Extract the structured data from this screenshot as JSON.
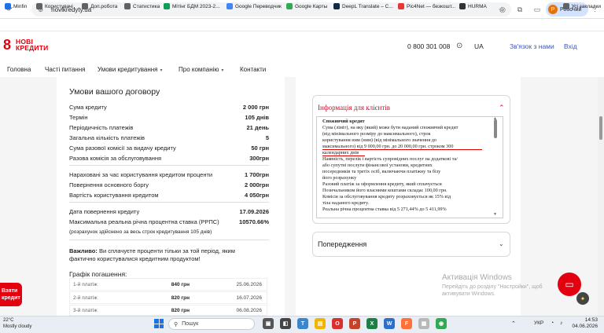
{
  "browser": {
    "url": "novikredyty.ua",
    "profile_initial": "Р",
    "profile_name": "Робочий",
    "bookmarks": [
      {
        "label": "Minfin",
        "color": "#1a73e8"
      },
      {
        "label": "Користувачі",
        "color": "#5f6368"
      },
      {
        "label": "Доп.робота",
        "color": "#5f6368"
      },
      {
        "label": "Статистика",
        "color": "#5f6368"
      },
      {
        "label": "Мітінг БДМ 2023-2...",
        "color": "#0f9d58"
      },
      {
        "label": "Google Переводчик",
        "color": "#4285f4"
      },
      {
        "label": "Google Карты",
        "color": "#34a853"
      },
      {
        "label": "DeepL Translate – С...",
        "color": "#0f2b46"
      },
      {
        "label": "Pic4Net — безкошт...",
        "color": "#e53935"
      },
      {
        "label": "HURMA",
        "color": "#333333"
      }
    ],
    "all_bookmarks": "Усі закладки"
  },
  "site": {
    "logo_line1": "НОВІ",
    "logo_line2": "КРЕДИТИ",
    "phone": "0 800 301 008",
    "lang": "UA",
    "contact": "Зв'язок з нами",
    "login": "Вхід",
    "menu": [
      {
        "label": "Головна",
        "dropdown": false
      },
      {
        "label": "Часті питання",
        "dropdown": false
      },
      {
        "label": "Умови кредитування",
        "dropdown": true
      },
      {
        "label": "Про компанію",
        "dropdown": true
      },
      {
        "label": "Контакти",
        "dropdown": false
      }
    ]
  },
  "contract": {
    "title": "Умови вашого договору",
    "group1": [
      {
        "label": "Сума кредиту",
        "value": "2 000 грн"
      },
      {
        "label": "Термін",
        "value": "105 днів"
      },
      {
        "label": "Періодичність платежів",
        "value": "21 день"
      },
      {
        "label": "Загальна кількість платежів",
        "value": "5"
      },
      {
        "label": "Сума разової комісії за видачу кредиту",
        "value": "50 грн"
      },
      {
        "label": "Разова комісія за обслуговування",
        "value": "300грн"
      }
    ],
    "group2": [
      {
        "label": "Нараховані за час користування кредитом проценти",
        "value": "1 700грн"
      },
      {
        "label": "Повернення основного боргу",
        "value": "2 000грн"
      },
      {
        "label": "Вартість користування кредитом",
        "value": "4 050грн"
      }
    ],
    "group3": [
      {
        "label": "Дата повернення кредиту",
        "value": "17.09.2026"
      },
      {
        "label": "Максимальна реальна річна процентна ставка (РРПС)",
        "value": "10570.66%"
      }
    ],
    "note": "(розрахунок здійснено за весь строк кредитування 105 днів)",
    "important_bold": "Важливо:",
    "important_text": " Ви сплачуєте проценти тільки за той період, яким фактично користувалися кредитним продуктом!",
    "schedule_title": "Графік погашення:",
    "schedule": [
      {
        "n": "1-й платіж",
        "amount": "840 грн",
        "date": "25.06.2026"
      },
      {
        "n": "2-й платіж",
        "amount": "820 грн",
        "date": "16.07.2026"
      },
      {
        "n": "3-й платіж",
        "amount": "820 грн",
        "date": "06.08.2026"
      }
    ]
  },
  "info": {
    "title": "Інформація для клієнтів",
    "heading": "Споживчий кредит",
    "lines": [
      "Сума (ліміт), на яку (який) може бути наданий споживчий кредит",
      "(від мінімального розміру до максимального), строк",
      "користування ним (ним) (від мінімального значення до",
      "максимального) від 9 000,00 грн. до 20 000,00 грн. строком 300",
      "календарних днів",
      "Наявність, перелік і вартість супровідних послуг на додаткові та/",
      "або супутні послуги фінансової установи, кредитних",
      "посередників та третіх осіб, включаючи платіжну та бізу",
      "його розрахунку",
      "Разовий платіж за оформлення кредиту, який сплачується",
      "Позичальником його власними коштами складає 100,00 грн.",
      "Комісія за обслуговування кредиту розраховується як 15% від",
      "тіла наданого кредиту.",
      "Реальна річна процентна ставка від 5 271,44% до 5 411,99%"
    ],
    "warnings_title": "Попередження"
  },
  "side_button": "Взяти кредит",
  "watermark": {
    "title": "Активація Windows",
    "text": "Перейдіть до розділу \"Настройки\", щоб активувати Windows."
  },
  "taskbar": {
    "temp": "22°C",
    "weather": "Mostly cloudy",
    "search": "Пошук",
    "lang": "УКР",
    "time": "14:53",
    "date": "04.06.2026"
  }
}
